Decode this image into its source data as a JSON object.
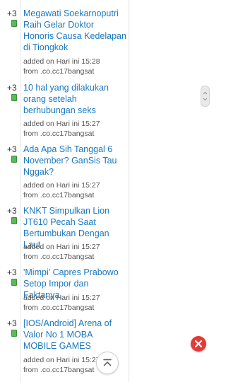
{
  "feed": {
    "items": [
      {
        "score": "+3",
        "title": "Megawati Soekarnoputri Raih Gelar Doktor Honoris Causa Kedelapan di Tiongkok",
        "added": "added on Hari ini 15:28",
        "from": "from .co.cc17bangsat"
      },
      {
        "score": "+3",
        "title": "10 hal yang dilakukan orang setelah berhubungan seks",
        "added": "added on Hari ini 15:27",
        "from": "from .co.cc17bangsat"
      },
      {
        "score": "+3",
        "title": "Ada Apa Sih Tanggal 6 November? GanSis Tau Nggak?",
        "added": "added on Hari ini 15:27",
        "from": "from .co.cc17bangsat"
      },
      {
        "score": "+3",
        "title": "KNKT Simpulkan Lion JT610 Pecah Saat Bertumbukan Dengan Laut",
        "added": "added on Hari ini 15:27",
        "from": "from .co.cc17bangsat"
      },
      {
        "score": "+3",
        "title": "'Mimpi' Capres Prabowo Setop Impor dan Faktanya",
        "added": "added on Hari ini 15:27",
        "from": "from .co.cc17bangsat"
      },
      {
        "score": "+3",
        "title": "[IOS/Android] Arena of Valor No 1 MOBA MOBILE GAMES",
        "added": "added on Hari ini 15:27",
        "from": "from .co.cc17bangsat"
      }
    ]
  },
  "colors": {
    "link": "#1a78c2",
    "status_dot": "#5cb85c",
    "close_button": "#e53935"
  },
  "icons": {
    "close": "close-icon",
    "back_to_top": "chevron-up-icon",
    "scroll": "scroll-grip-icon"
  }
}
